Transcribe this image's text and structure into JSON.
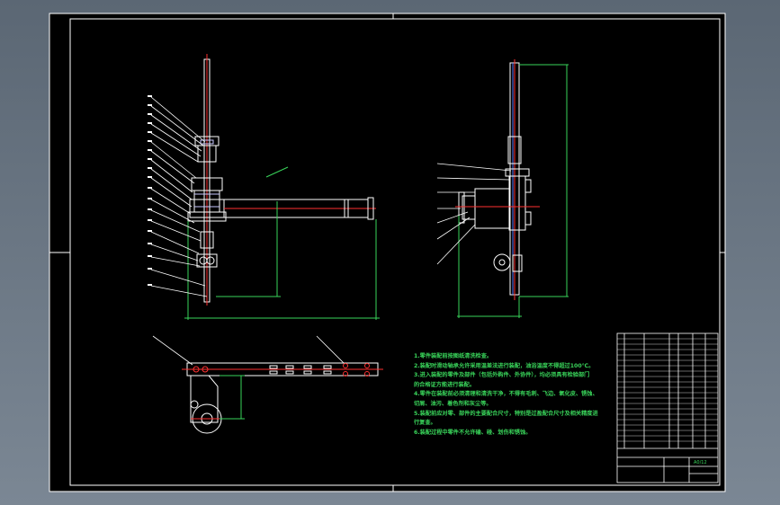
{
  "title_block": {
    "drawing_number": "A0/12"
  },
  "notes": [
    "1.零件装配前按图纸清洗检查。",
    "2.装配时滑动轴承允许采用温差法进行装配，油浴温度不得超过100℃。",
    "3.进入装配的零件及部件（包括外购件、外协件），均必须具有检验部门",
    "的合格证方能进行装配。",
    "4.零件在装配前必须清理和清洗干净，不得有毛刺、飞边、氧化皮、锈蚀、",
    "切屑、油污、着色剂和灰尘等。",
    "5.装配前应对零、部件的主要配合尺寸，特别是过盈配合尺寸及相关精度进",
    "行复查。",
    "6.装配过程中零件不允许磕、碰、划伤和锈蚀。"
  ],
  "colors": {
    "sheet": "#000000",
    "border": "#ffffff",
    "outline": "#ffffff",
    "dimension": "#39d45a",
    "centerline": "#ff3030",
    "hidden": "#4d7dff",
    "part": "#c8c8ff"
  }
}
